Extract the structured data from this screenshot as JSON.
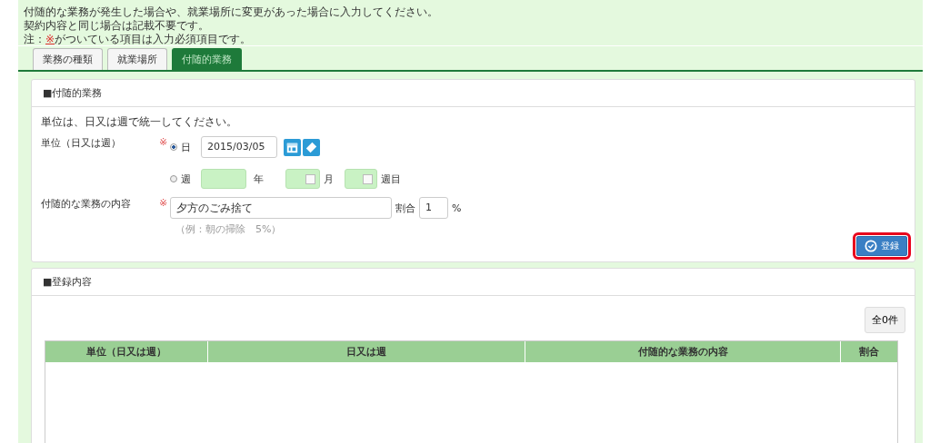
{
  "notes": [
    {
      "text": "付随的な業務が発生した場合や、就業場所に変更があった場合に入力してください。"
    },
    {
      "text": "契約内容と同じ場合は記載不要です。"
    },
    {
      "prefix": "注：",
      "mark": "※",
      "text": "がついている項目は入力必須項目です。"
    }
  ],
  "tabs": [
    {
      "label": "業務の種類",
      "selected": false
    },
    {
      "label": "就業場所",
      "selected": false
    },
    {
      "label": "付随的業務",
      "selected": true
    }
  ],
  "section": {
    "title": "■付随的業務",
    "instruction": "単位は、日又は週で統一してください。",
    "unit": {
      "label": "単位（日又は週）",
      "required": "※",
      "day": {
        "label": "日",
        "selected": true,
        "value": "2015/03/05"
      },
      "week": {
        "label": "週",
        "selected": false,
        "year_unit": "年",
        "month_unit": "月",
        "week_unit": "週目"
      }
    },
    "content": {
      "label": "付随的な業務の内容",
      "required": "※",
      "value": "夕方のごみ捨て",
      "ratio_label": "割合",
      "ratio_value": "1",
      "ratio_unit": "%",
      "hint": "（例：朝の掃除　5%）"
    },
    "register_button": {
      "label": "登録",
      "highlighted": true
    }
  },
  "registered": {
    "title": "■登録内容",
    "count": "全0件",
    "columns": [
      "単位（日又は週）",
      "日又は週",
      "付随的な業務の内容",
      "割合"
    ]
  }
}
